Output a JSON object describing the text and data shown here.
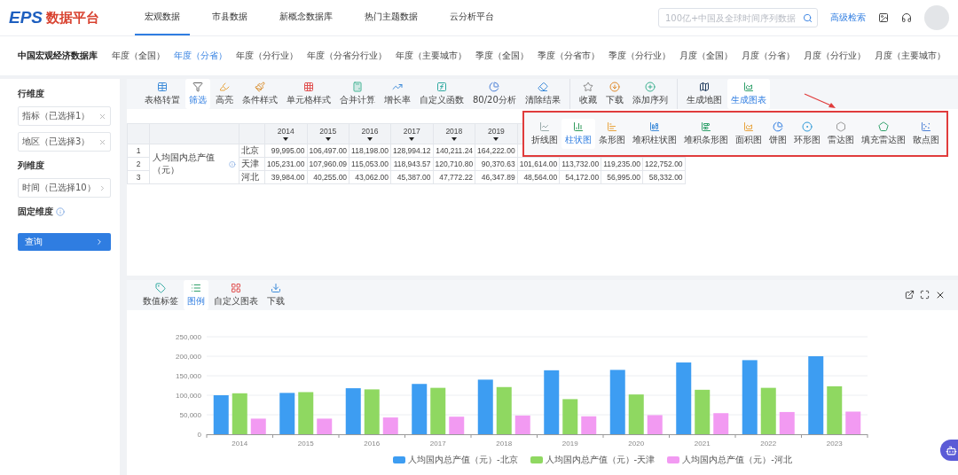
{
  "header": {
    "logo_mark": "EPS",
    "logo_text": "数据平台",
    "nav": [
      {
        "label": "宏观数据",
        "selected": true
      },
      {
        "label": "市县数据",
        "selected": false
      },
      {
        "label": "新概念数据库",
        "selected": false
      },
      {
        "label": "热门主题数据",
        "selected": false
      },
      {
        "label": "云分析平台",
        "selected": false
      }
    ],
    "search": {
      "placeholder": "100亿+中国及全球时间序列数据"
    },
    "advanced_search": "高级检索"
  },
  "database": {
    "title": "中国宏观经济数据库",
    "tabs": [
      {
        "label": "年度（全国）",
        "selected": false
      },
      {
        "label": "年度（分省）",
        "selected": true
      },
      {
        "label": "年度（分行业）",
        "selected": false
      },
      {
        "label": "年度（分省分行业）",
        "selected": false
      },
      {
        "label": "年度（主要城市）",
        "selected": false
      },
      {
        "label": "季度（全国）",
        "selected": false
      },
      {
        "label": "季度（分省市）",
        "selected": false
      },
      {
        "label": "季度（分行业）",
        "selected": false
      },
      {
        "label": "月度（全国）",
        "selected": false
      },
      {
        "label": "月度（分省）",
        "selected": false
      },
      {
        "label": "月度（分行业）",
        "selected": false
      },
      {
        "label": "月度（主要城市）",
        "selected": false
      }
    ]
  },
  "sidebar": {
    "row_dimension": "行维度",
    "row_selects": [
      {
        "value": "指标（已选择1）",
        "kind": "clear"
      },
      {
        "value": "地区（已选择3）",
        "kind": "clear"
      }
    ],
    "column_dimension": "列维度",
    "column_selects": [
      {
        "value": "时间（已选择10）",
        "kind": "arrow"
      }
    ],
    "fixed_dimension": "固定维度",
    "query_button": "查询"
  },
  "toolbar": {
    "groups": [
      [
        {
          "label": "表格转置",
          "selected": false
        },
        {
          "label": "筛选",
          "selected": true
        },
        {
          "label": "高亮",
          "selected": false
        },
        {
          "label": "条件样式",
          "selected": false
        },
        {
          "label": "单元格样式",
          "selected": false
        },
        {
          "label": "合并计算",
          "selected": false
        },
        {
          "label": "增长率",
          "selected": false
        },
        {
          "label": "自定义函数",
          "selected": false
        },
        {
          "label": "80/20分析",
          "selected": false
        },
        {
          "label": "清除结果",
          "selected": false
        }
      ],
      [
        {
          "label": "收藏",
          "selected": false
        },
        {
          "label": "下载",
          "selected": false
        },
        {
          "label": "添加序列",
          "selected": false
        }
      ],
      [
        {
          "label": "生成地图",
          "selected": false
        },
        {
          "label": "生成图表",
          "selected": true
        }
      ]
    ]
  },
  "chart_types": [
    {
      "label": "折线图",
      "selected": false
    },
    {
      "label": "柱状图",
      "selected": true
    },
    {
      "label": "条形图",
      "selected": false
    },
    {
      "label": "堆积柱状图",
      "selected": false
    },
    {
      "label": "堆积条形图",
      "selected": false
    },
    {
      "label": "面积图",
      "selected": false
    },
    {
      "label": "饼图",
      "selected": false
    },
    {
      "label": "环形图",
      "selected": false
    },
    {
      "label": "雷达图",
      "selected": false
    },
    {
      "label": "填充雷达图",
      "selected": false
    },
    {
      "label": "散点图",
      "selected": false
    }
  ],
  "table": {
    "columns": [
      "2014",
      "2015",
      "2016",
      "2017",
      "2018",
      "2019"
    ],
    "indicator": "人均国内总产值（元）",
    "rows": [
      {
        "index": "1",
        "region": "北京",
        "values": [
          "99,995.00",
          "106,497.00",
          "118,198.00",
          "128,994.12",
          "140,211.24",
          "164,222.00"
        ]
      },
      {
        "index": "2",
        "region": "天津",
        "values": [
          "105,231.00",
          "107,960.09",
          "115,053.00",
          "118,943.57",
          "120,710.80",
          "90,370.63",
          "101,614.00",
          "113,732.00",
          "119,235.00",
          "122,752.00"
        ]
      },
      {
        "index": "3",
        "region": "河北",
        "values": [
          "39,984.00",
          "40,255.00",
          "43,062.00",
          "45,387.00",
          "47,772.22",
          "46,347.89",
          "48,564.00",
          "54,172.00",
          "56,995.00",
          "58,332.00"
        ]
      }
    ]
  },
  "chart_panel": {
    "tools": [
      {
        "label": "数值标签",
        "selected": false
      },
      {
        "label": "图例",
        "selected": true
      },
      {
        "label": "自定义图表",
        "selected": false
      },
      {
        "label": "下载",
        "selected": false
      }
    ],
    "chart_data": {
      "type": "bar",
      "categories": [
        "2014",
        "2015",
        "2016",
        "2017",
        "2018",
        "2019",
        "2020",
        "2021",
        "2022",
        "2023"
      ],
      "ylim": [
        0,
        250000
      ],
      "grid": true,
      "legend": "bottom",
      "yticks": [
        {
          "value": 0,
          "label": "0"
        },
        {
          "value": 50000,
          "label": "50,000"
        },
        {
          "value": 100000,
          "label": "100,000"
        },
        {
          "value": 150000,
          "label": "150,000"
        },
        {
          "value": 200000,
          "label": "200,000"
        },
        {
          "value": 250000,
          "label": "250,000"
        }
      ],
      "series": [
        {
          "name": "人均国内总产值（元）-北京",
          "color": "#3d9df2",
          "values": [
            100000,
            106000,
            118000,
            129000,
            140000,
            164000,
            165000,
            184000,
            190000,
            200000
          ]
        },
        {
          "name": "人均国内总产值（元）-天津",
          "color": "#8fd861",
          "values": [
            105000,
            108000,
            115000,
            119000,
            121000,
            90000,
            102000,
            114000,
            119000,
            123000
          ]
        },
        {
          "name": "人均国内总产值（元）-河北",
          "color": "#f29af2",
          "values": [
            40000,
            40000,
            43000,
            45000,
            48000,
            46000,
            49000,
            54000,
            57000,
            58000
          ]
        }
      ]
    }
  }
}
